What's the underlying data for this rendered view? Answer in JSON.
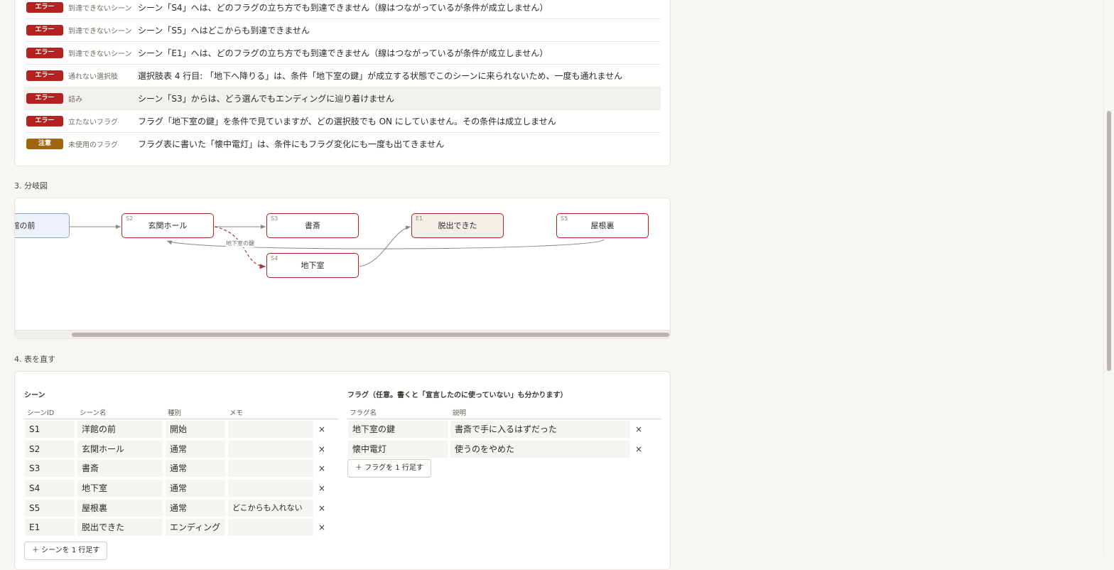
{
  "issues": [
    {
      "type": "err",
      "badge": "エラー",
      "category": "到達できないシーン",
      "message": "シーン「S4」へは、どのフラグの立ち方でも到達できません（線はつながっているが条件が成立しません）"
    },
    {
      "type": "err",
      "badge": "エラー",
      "category": "到達できないシーン",
      "message": "シーン「S5」へはどこからも到達できません"
    },
    {
      "type": "err",
      "badge": "エラー",
      "category": "到達できないシーン",
      "message": "シーン「E1」へは、どのフラグの立ち方でも到達できません（線はつながっているが条件が成立しません）"
    },
    {
      "type": "err",
      "badge": "エラー",
      "category": "通れない選択肢",
      "message": "選択肢表 4 行目: 「地下へ降りる」は、条件「地下室の鍵」が成立する状態でこのシーンに来られないため、一度も通れません"
    },
    {
      "type": "err",
      "badge": "エラー",
      "category": "詰み",
      "message": "シーン「S3」からは、どう選んでもエンディングに辿り着けません",
      "highlight": true
    },
    {
      "type": "err",
      "badge": "エラー",
      "category": "立たないフラグ",
      "message": "フラグ「地下室の鍵」を条件で見ていますが、どの選択肢でも ON にしていません。その条件は成立しません"
    },
    {
      "type": "warn",
      "badge": "注意",
      "category": "未使用のフラグ",
      "message": "フラグ表に書いた「懐中電灯」は、条件にもフラグ変化にも一度も出てきません"
    }
  ],
  "section3": {
    "title": "3. 分岐図"
  },
  "diagram": {
    "nodes": {
      "s1": {
        "id": "",
        "label": "館の前"
      },
      "s2": {
        "id": "S2",
        "label": "玄関ホール"
      },
      "s3": {
        "id": "S3",
        "label": "書斎"
      },
      "s4": {
        "id": "S4",
        "label": "地下室"
      },
      "e1": {
        "id": "E1",
        "label": "脱出できた"
      },
      "s5": {
        "id": "S5",
        "label": "屋根裏"
      }
    },
    "edge_label": "地下室の鍵"
  },
  "section4": {
    "title": "4. 表を直す"
  },
  "scenes": {
    "title": "シーン",
    "headers": [
      "シーンID",
      "シーン名",
      "種別",
      "メモ"
    ],
    "rows": [
      {
        "id": "S1",
        "name": "洋館の前",
        "kind": "開始",
        "memo": ""
      },
      {
        "id": "S2",
        "name": "玄関ホール",
        "kind": "通常",
        "memo": ""
      },
      {
        "id": "S3",
        "name": "書斎",
        "kind": "通常",
        "memo": ""
      },
      {
        "id": "S4",
        "name": "地下室",
        "kind": "通常",
        "memo": ""
      },
      {
        "id": "S5",
        "name": "屋根裏",
        "kind": "通常",
        "memo": "どこからも入れない"
      },
      {
        "id": "E1",
        "name": "脱出できた",
        "kind": "エンディング",
        "memo": ""
      }
    ],
    "delete_label": "×",
    "add_label": "＋ シーンを 1 行足す"
  },
  "flags": {
    "title": "フラグ（任意。書くと「宣言したのに使っていない」も分かります）",
    "headers": [
      "フラグ名",
      "説明"
    ],
    "rows": [
      {
        "name": "地下室の鍵",
        "desc": "書斎で手に入るはずだった"
      },
      {
        "name": "懐中電灯",
        "desc": "使うのをやめた"
      }
    ],
    "delete_label": "×",
    "add_label": "＋ フラグを 1 行足す"
  }
}
